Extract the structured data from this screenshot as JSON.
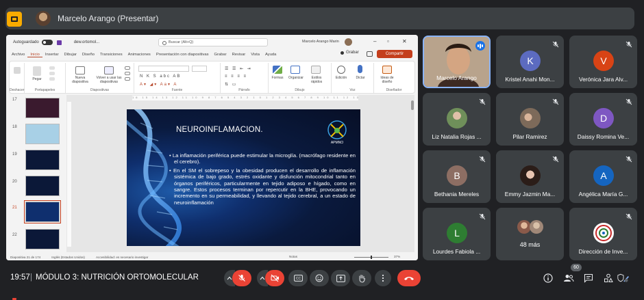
{
  "top_bar": {
    "presenter_label": "Marcelo Arango (Presentar)"
  },
  "powerpoint": {
    "autosave_label": "Autoguardado",
    "file_name": "dew.ortomol...",
    "search_placeholder": "Buscar (Alt+Q)",
    "user_name": "Marcelo Arango Marin",
    "tabs": [
      "Archivo",
      "Inicio",
      "Insertar",
      "Dibujar",
      "Diseño",
      "Transiciones",
      "Animaciones",
      "Presentación con diapositivas",
      "Grabar",
      "Revisar",
      "Vista",
      "Ayuda"
    ],
    "active_tab": "Inicio",
    "grabar_label": "Grabar",
    "share_label": "Compartir",
    "ribbon": {
      "paste_label": "Pegar",
      "new_slide_label": "Nueva diapositiva",
      "reuse_label": "Volver a usar las diapositivas",
      "shapes_label": "Formas",
      "arrange_label": "Organizar",
      "quick_styles_label": "Estilos rápidos",
      "editing_label": "Edición",
      "dictate_label": "Dictar",
      "designer_label": "Ideas de diseño",
      "groups": [
        "Deshacer",
        "Portapapeles",
        "Diapositivas",
        "Fuente",
        "Párrafo",
        "Dibujo",
        "Voz",
        "Diseñador"
      ]
    },
    "thumbnails": [
      {
        "num": "17",
        "color": "#3a1a2e"
      },
      {
        "num": "18",
        "color": "#a8d0e6"
      },
      {
        "num": "19",
        "color": "#0b1838"
      },
      {
        "num": "20",
        "color": "#0b1838"
      },
      {
        "num": "21",
        "color": "#0f2f6e",
        "selected": true
      },
      {
        "num": "22",
        "color": "#0b1838"
      }
    ],
    "slide": {
      "title": "NEUROINFLAMACION.",
      "logo_text": "APMNO",
      "bullet_1": "• La inflamación periférica puede estimular la microglía. (macrófago residente en el cerebro).",
      "bullet_2": "• En el SM el sobrepeso y la obesidad producen el desarrollo de inflamación sistémica de bajo grado, estrés oxidante y disfunción mitocondrial tanto en órganos periféricos, particularmente en tejido adiposo e hígado, como en sangre. Estos procesos terminan por repercutir en la BHE, provocando un incremento en su permeabilidad, y llevando al tejido cerebral, a un estado de neuroinflamación"
    },
    "status": {
      "slide_count": "Diapositiva 21 de 174",
      "language": "Inglés (Estados Unidos)",
      "accessibility": "Accesibilidad: es necesario investigar",
      "notes": "Notas",
      "zoom": "37%"
    }
  },
  "participants": [
    {
      "name": "Marcelo Arango",
      "type": "video"
    },
    {
      "name": "Kristel Anahi Mon...",
      "initial": "K",
      "color": "#5c6bc0"
    },
    {
      "name": "Verónica Jara Alv...",
      "initial": "V",
      "color": "#d84315"
    },
    {
      "name": "Liz Natalia Rojas ...",
      "type": "photo",
      "photo": "#6f8f5a"
    },
    {
      "name": "Pilar Ramirez",
      "type": "photo",
      "photo": "#7d6a5a"
    },
    {
      "name": "Daissy Romina Ve...",
      "initial": "D",
      "color": "#7e57c2"
    },
    {
      "name": "Bethania Mereles",
      "initial": "B",
      "color": "#8d6e63"
    },
    {
      "name": "Emmy Jazmin Ma...",
      "type": "photo",
      "photo": "#b58a7a"
    },
    {
      "name": "Angélica María G...",
      "initial": "A",
      "color": "#1565c0"
    },
    {
      "name": "Lourdes Fabiola ...",
      "initial": "L",
      "color": "#2e7d32"
    },
    {
      "name": "48 más",
      "type": "more"
    },
    {
      "name": "Dirección de Inve...",
      "type": "logo"
    }
  ],
  "bottom_bar": {
    "time": "19:57",
    "separator": "|",
    "meeting_name": "MÓDULO 3: NUTRICIÓN ORTOMOLECULAR",
    "people_count": "60"
  }
}
